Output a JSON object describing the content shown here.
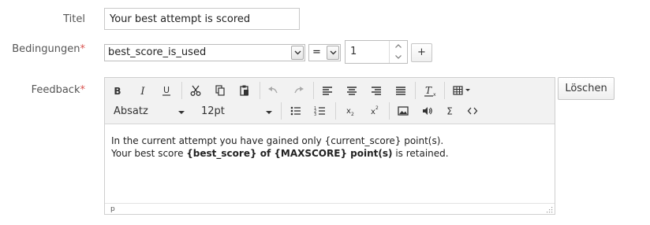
{
  "form": {
    "title_label": "Titel",
    "title_value": "Your best attempt is scored",
    "conditions_label": "Bedingungen",
    "required_mark": "*",
    "condition_select": "best_score_is_used",
    "operator_select": "=",
    "value_number": "1",
    "add_label": "+",
    "feedback_label": "Feedback",
    "delete_label": "Löschen"
  },
  "editor": {
    "block_format": "Absatz",
    "font_size": "12pt",
    "line1": "In the current attempt you have gained only {current_score} point(s).",
    "line2_start": "Your best score ",
    "line2_bold": "{best_score} of {MAXSCORE} point(s)",
    "line2_end": " is retained.",
    "path": "p",
    "toolbar_icons": [
      "bold-icon",
      "italic-icon",
      "underline-icon",
      "cut-icon",
      "copy-icon",
      "paste-icon",
      "undo-icon",
      "redo-icon",
      "align-left-icon",
      "align-center-icon",
      "align-right-icon",
      "align-justify-icon",
      "clear-format-icon",
      "table-icon",
      "bullet-list-icon",
      "numbered-list-icon",
      "subscript-icon",
      "superscript-icon",
      "image-icon",
      "media-icon",
      "sum-icon",
      "code-icon"
    ]
  }
}
